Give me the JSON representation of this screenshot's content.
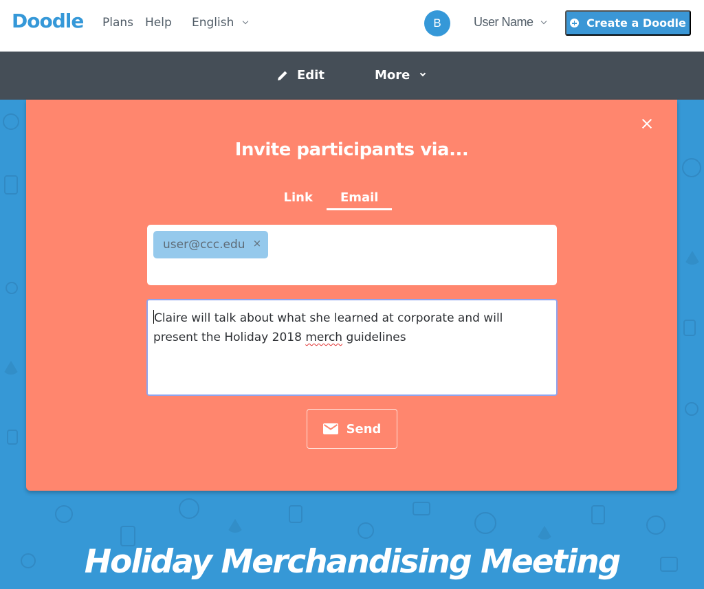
{
  "header": {
    "logo": "Doodle",
    "nav": [
      {
        "label": "Plans"
      },
      {
        "label": "Help"
      }
    ],
    "language": {
      "selected": "English",
      "icon": "chevron-down-icon"
    },
    "user": {
      "avatar_initial": "B",
      "name": "User Name",
      "icon": "chevron-down-icon"
    },
    "create_button": {
      "label": "Create a Doodle",
      "icon": "plus-circle-icon"
    },
    "brand_color": "#3598d8"
  },
  "subnav": {
    "items": [
      {
        "label": "Edit",
        "icon": "pencil-icon"
      },
      {
        "label": "More",
        "icon": "chevron-down-icon"
      }
    ],
    "background": "#454e57"
  },
  "modal": {
    "title": "Invite participants via...",
    "close_icon": "close-icon",
    "tabs": [
      {
        "label": "Link",
        "active": false
      },
      {
        "label": "Email",
        "active": true
      }
    ],
    "recipients": [
      {
        "email": "user@ccc.edu",
        "remove_icon": "close-icon"
      }
    ],
    "message": {
      "line_1": "Claire will talk about what she learned at corporate and will",
      "line_2_before": "present the Holiday 2018 ",
      "misspelled": "merch",
      "line_2_after": " guidelines"
    },
    "send_button": {
      "label": "Send",
      "icon": "envelope-icon"
    },
    "background": "#ff866e"
  },
  "poll": {
    "title": "Holiday Merchandising Meeting"
  }
}
